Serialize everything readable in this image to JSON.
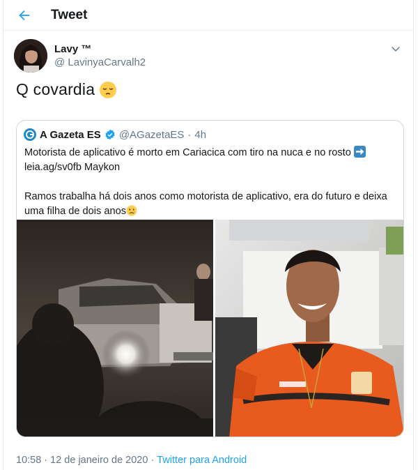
{
  "header": {
    "title": "Tweet",
    "back_icon": "back-arrow-icon"
  },
  "tweet": {
    "author_name": "Lavy ™",
    "author_handle": "@ LavinyaCarvalh2",
    "text": "Q covardia",
    "text_emoji": "pensive-face"
  },
  "quoted": {
    "name": "A Gazeta ES",
    "handle": "@AGazetaES",
    "separator": "·",
    "time": "4h",
    "line1": "Motorista de aplicativo é morto em Cariacica com tiro na nuca e no rosto",
    "line2": "leia.ag/sv0fb Maykon",
    "line3": "Ramos trabalha há dois anos como motorista de aplicativo, era do futuro e deixa",
    "line4": "uma filha de dois anos",
    "line4_emoji": "crying-face"
  },
  "meta": {
    "time": "10:58",
    "separator": "·",
    "date": "12 de janeiro de 2020",
    "separator2": "·",
    "source": "Twitter para Android"
  },
  "colors": {
    "accent": "#1da1f2",
    "muted": "#657786",
    "border": "#e6ecf0"
  }
}
